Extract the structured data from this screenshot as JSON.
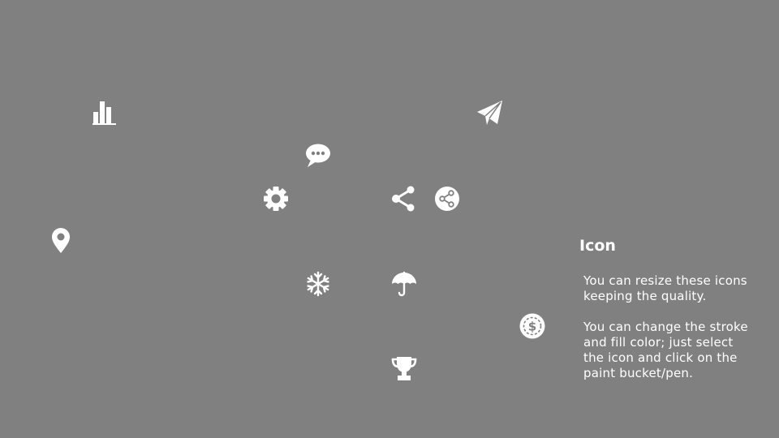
{
  "info": {
    "title": "Icon",
    "paragraph_1": "You can resize these icons keeping the quality.",
    "paragraph_2": "You can change the stroke and fill color; just select the icon and click on the paint bucket/pen."
  },
  "icons": [
    "bar-chart-icon",
    "paper-plane-icon",
    "speech-bubble-icon",
    "gear-icon",
    "share-icon",
    "share-circle-icon",
    "location-pin-icon",
    "snowflake-icon",
    "umbrella-icon",
    "dollar-coin-icon",
    "trophy-icon"
  ],
  "colors": {
    "background": "#808080",
    "foreground": "#ffffff"
  }
}
